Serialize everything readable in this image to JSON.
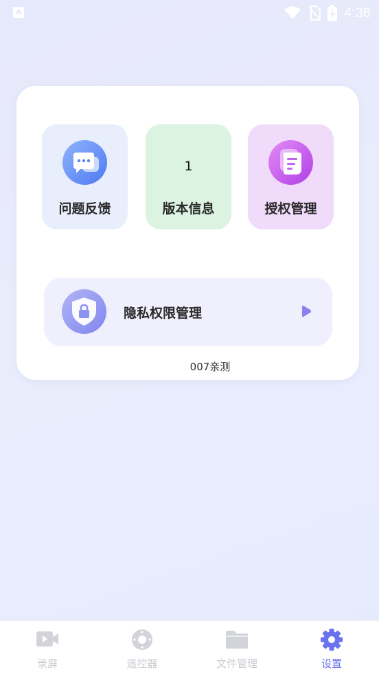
{
  "status_bar": {
    "app_badge": "A",
    "time": "4:36"
  },
  "tiles": [
    {
      "label": "问题反馈",
      "icon": "chat-bubble-icon"
    },
    {
      "label": "版本信息",
      "value": "1"
    },
    {
      "label": "授权管理",
      "icon": "document-icon"
    }
  ],
  "privacy": {
    "label": "隐私权限管理",
    "icon": "shield-lock-icon"
  },
  "footnote": "007亲测",
  "nav": {
    "items": [
      {
        "label": "录屏",
        "icon": "video-camera-icon",
        "active": false
      },
      {
        "label": "遥控器",
        "icon": "remote-control-icon",
        "active": false
      },
      {
        "label": "文件管理",
        "icon": "folder-icon",
        "active": false
      },
      {
        "label": "设置",
        "icon": "gear-icon",
        "active": true
      }
    ]
  },
  "colors": {
    "accent": "#6b72ee",
    "inactive": "#c9cbd1"
  }
}
